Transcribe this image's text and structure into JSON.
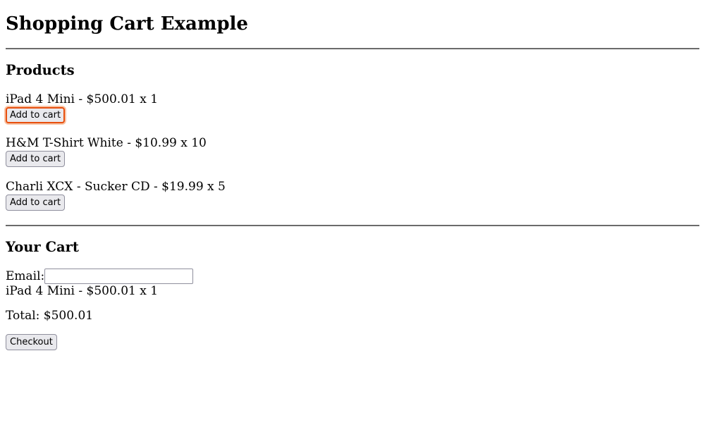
{
  "page_title": "Shopping Cart Example",
  "products_section": {
    "heading": "Products",
    "items": [
      {
        "line": "iPad 4 Mini - $500.01 x 1",
        "button_label": "Add to cart"
      },
      {
        "line": "H&M T-Shirt White - $10.99 x 10",
        "button_label": "Add to cart"
      },
      {
        "line": "Charli XCX - Sucker CD - $19.99 x 5",
        "button_label": "Add to cart"
      }
    ]
  },
  "cart_section": {
    "heading": "Your Cart",
    "email_label": "Email:",
    "email_value": "",
    "items": [
      {
        "line": "iPad 4 Mini - $500.01 x 1"
      }
    ],
    "total_text": "Total: $500.01",
    "checkout_label": "Checkout"
  },
  "colors": {
    "focus_ring": "#e8500f",
    "button_bg": "#e9e9ed"
  }
}
